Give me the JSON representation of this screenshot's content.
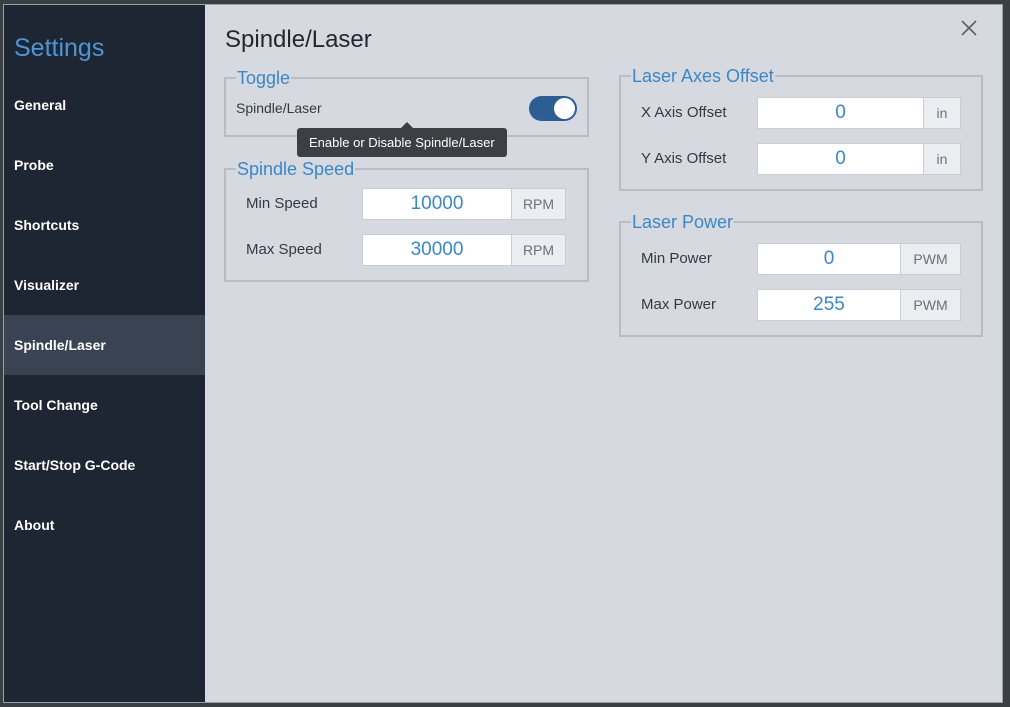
{
  "sidebar": {
    "title": "Settings",
    "items": [
      {
        "label": "General"
      },
      {
        "label": "Probe"
      },
      {
        "label": "Shortcuts"
      },
      {
        "label": "Visualizer"
      },
      {
        "label": "Spindle/Laser",
        "active": true
      },
      {
        "label": "Tool Change"
      },
      {
        "label": "Start/Stop G-Code"
      },
      {
        "label": "About"
      }
    ]
  },
  "page": {
    "title": "Spindle/Laser",
    "close_icon": "close-icon"
  },
  "toggle_group": {
    "legend": "Toggle",
    "label": "Spindle/Laser",
    "enabled": true,
    "tooltip": "Enable or Disable Spindle/Laser"
  },
  "spindle_speed": {
    "legend": "Spindle Speed",
    "min_label": "Min Speed",
    "min_value": "10000",
    "min_unit": "RPM",
    "max_label": "Max Speed",
    "max_value": "30000",
    "max_unit": "RPM"
  },
  "laser_axes_offset": {
    "legend": "Laser Axes Offset",
    "x_label": "X Axis Offset",
    "x_value": "0",
    "x_unit": "in",
    "y_label": "Y Axis Offset",
    "y_value": "0",
    "y_unit": "in"
  },
  "laser_power": {
    "legend": "Laser Power",
    "min_label": "Min Power",
    "min_value": "0",
    "min_unit": "PWM",
    "max_label": "Max Power",
    "max_value": "255",
    "max_unit": "PWM"
  },
  "colors": {
    "accent": "#3b87c8",
    "sidebar_bg": "#1e2633",
    "sidebar_active": "#3a4352",
    "toggle_on": "#2c5d93"
  }
}
